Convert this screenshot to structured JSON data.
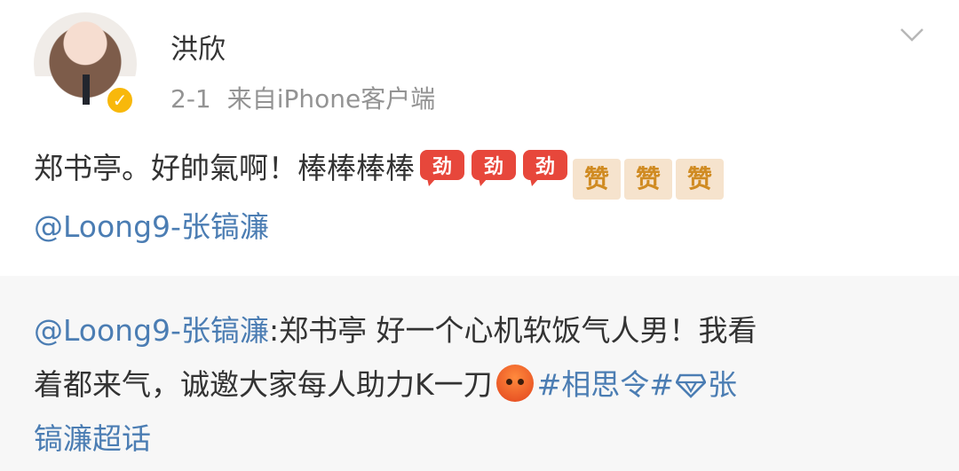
{
  "post": {
    "author": "洪欣",
    "time": "2-1",
    "source": "来自iPhone客户端",
    "text": "郑书亭。好帥氣啊！棒棒棒棒",
    "emoji_jiayou": [
      "[加油]",
      "[加油]",
      "[加油]"
    ],
    "emoji_zan_glyph": "赞",
    "mention": "@Loong9-张镐濂",
    "icons": {
      "verified": "verified-badge-icon",
      "menu": "chevron-down-icon"
    },
    "colors": {
      "link": "#4b7db3",
      "verified": "#f8b80b",
      "text": "#333333",
      "meta": "#939393"
    }
  },
  "repost": {
    "mention": "@Loong9-张镐濂",
    "line1_text": ":郑书亭 好一个心机软饭气人男！我看",
    "line2_text": "着都来气，诚邀大家每人助力K一刀",
    "emoji": "[怒]",
    "hashtag": "#相思令#",
    "supertopic_line2": "张",
    "supertopic_line3": "镐濂超话",
    "icons": {
      "supertopic": "diamond-supertopic-icon",
      "angry": "angry-face-icon"
    }
  }
}
